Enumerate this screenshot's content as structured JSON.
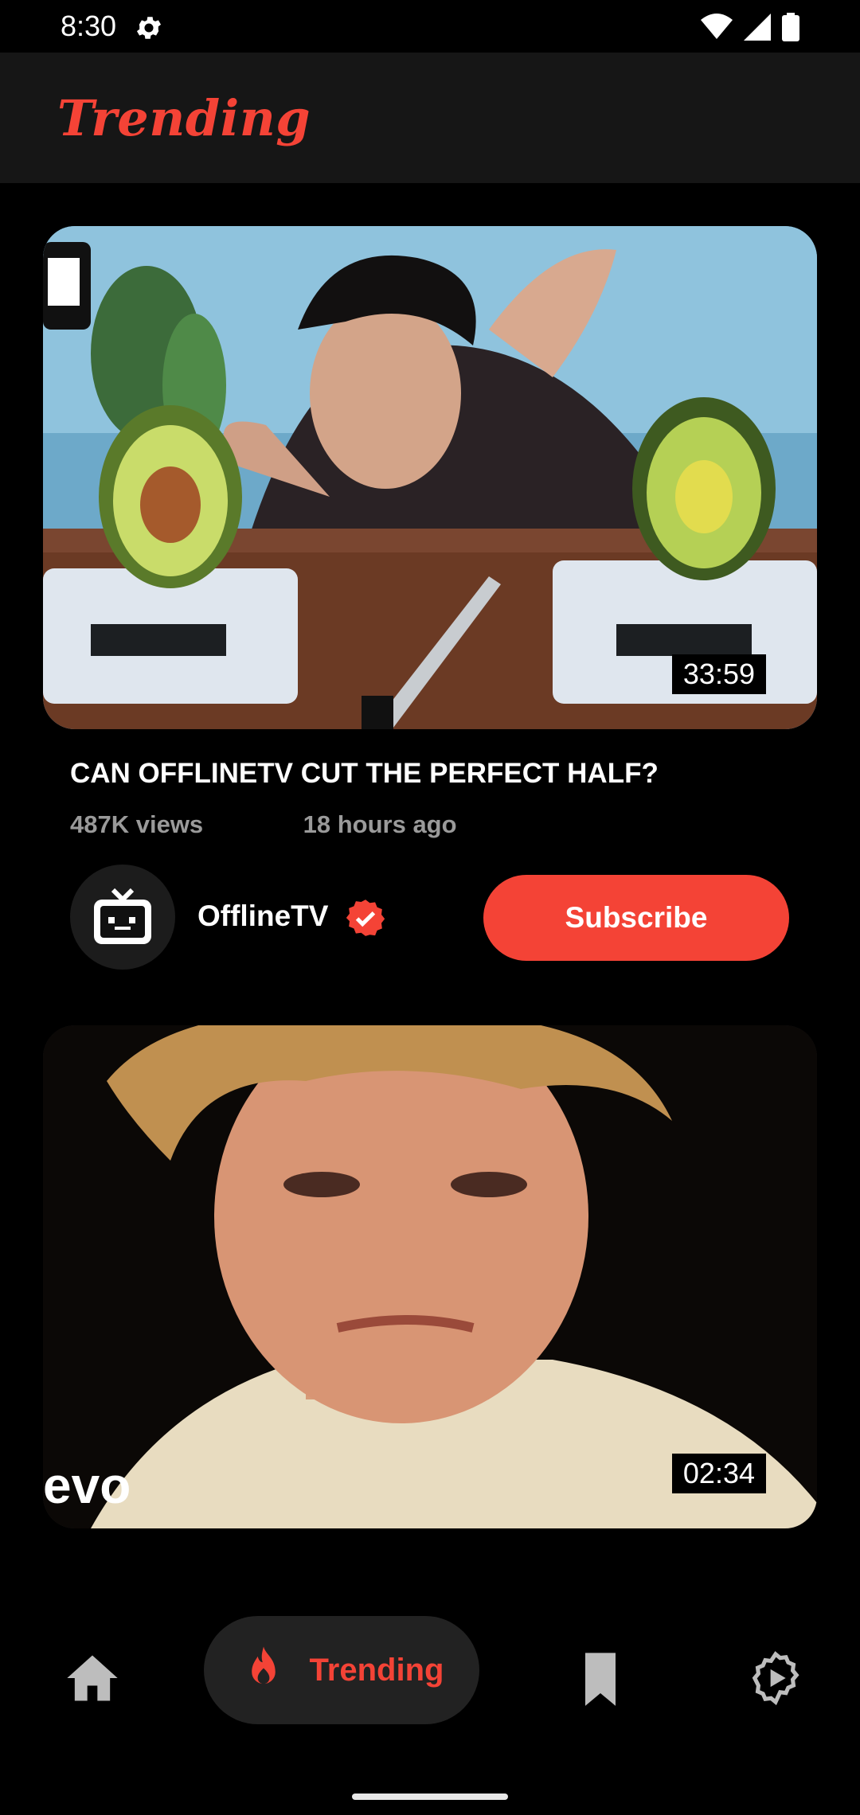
{
  "status_bar": {
    "time": "8:30"
  },
  "app_bar": {
    "title": "Trending"
  },
  "videos": [
    {
      "title": "CAN OFFLINETV CUT THE PERFECT HALF?",
      "views": "487K views",
      "uploaded": "18 hours ago",
      "duration": "33:59",
      "channel": "OfflineTV",
      "verified": true,
      "subscribe_label": "Subscribe"
    },
    {
      "duration": "02:34",
      "watermark": "evo"
    }
  ],
  "bottom_nav": {
    "items": [
      {
        "name": "home",
        "icon": "home-icon"
      },
      {
        "name": "trending",
        "icon": "flame-icon",
        "label": "Trending",
        "active": true
      },
      {
        "name": "bookmarks",
        "icon": "bookmark-icon"
      },
      {
        "name": "settings",
        "icon": "settings-icon"
      }
    ]
  },
  "colors": {
    "accent": "#f44336",
    "background": "#000000",
    "app_bar": "#161616",
    "muted_text": "#9a9a9a"
  }
}
